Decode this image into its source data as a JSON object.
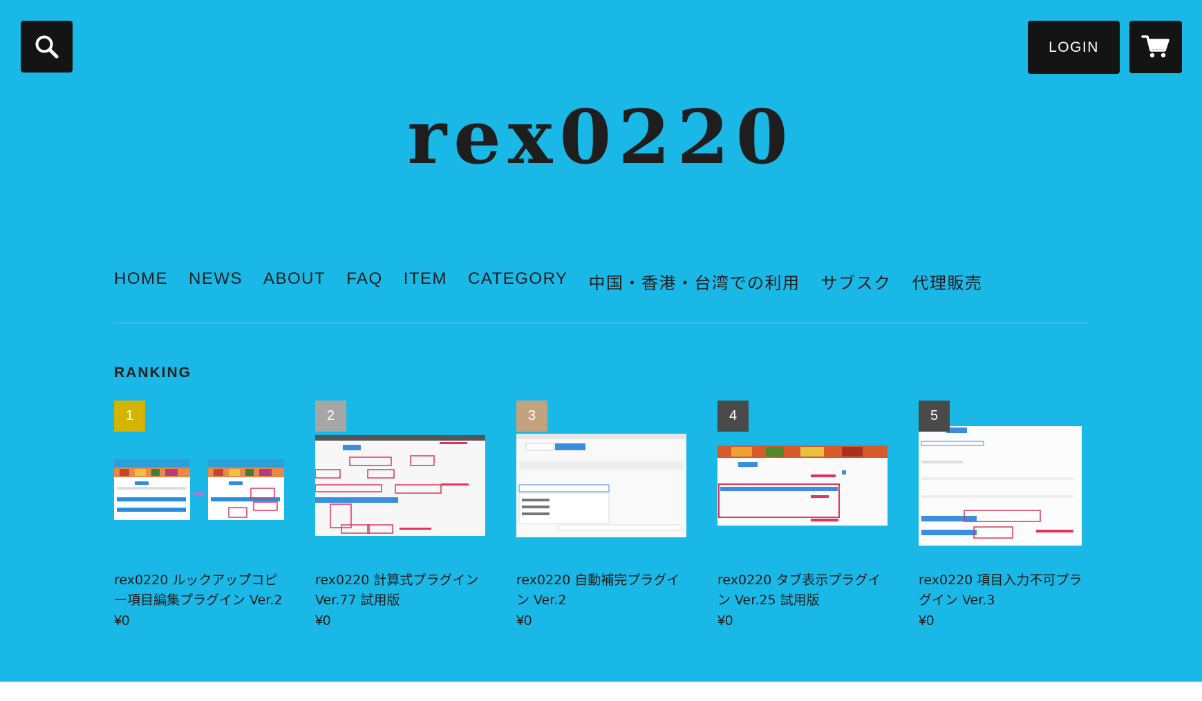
{
  "header": {
    "login_label": "LOGIN",
    "site_title": "rex0220"
  },
  "nav": {
    "items": [
      {
        "label": "HOME"
      },
      {
        "label": "NEWS"
      },
      {
        "label": "ABOUT"
      },
      {
        "label": "FAQ"
      },
      {
        "label": "ITEM"
      },
      {
        "label": "CATEGORY"
      },
      {
        "label": "中国・香港・台湾での利用"
      },
      {
        "label": "サブスク"
      },
      {
        "label": "代理販売"
      }
    ]
  },
  "ranking": {
    "title": "RANKING",
    "items": [
      {
        "rank": "1",
        "badge_color": "#d4b400",
        "title": "rex0220 ルックアップコピー項目編集プラグイン Ver.2",
        "price": "¥0"
      },
      {
        "rank": "2",
        "badge_color": "#a6a6a6",
        "title": "rex0220 計算式プラグイン Ver.77 試用版",
        "price": "¥0"
      },
      {
        "rank": "3",
        "badge_color": "#c2a37d",
        "title": "rex0220 自動補完プラグイン Ver.2",
        "price": "¥0"
      },
      {
        "rank": "4",
        "badge_color": "#4a4a4a",
        "title": "rex0220 タブ表示プラグイン Ver.25 試用版",
        "price": "¥0"
      },
      {
        "rank": "5",
        "badge_color": "#4a4a4a",
        "title": "rex0220 項目入力不可プラグイン Ver.3",
        "price": "¥0"
      }
    ]
  },
  "colors": {
    "background": "#1ab8e6",
    "button_dark": "#141414",
    "text": "#1e1e1e"
  },
  "icons": {
    "search": "search-icon",
    "cart": "cart-icon"
  }
}
